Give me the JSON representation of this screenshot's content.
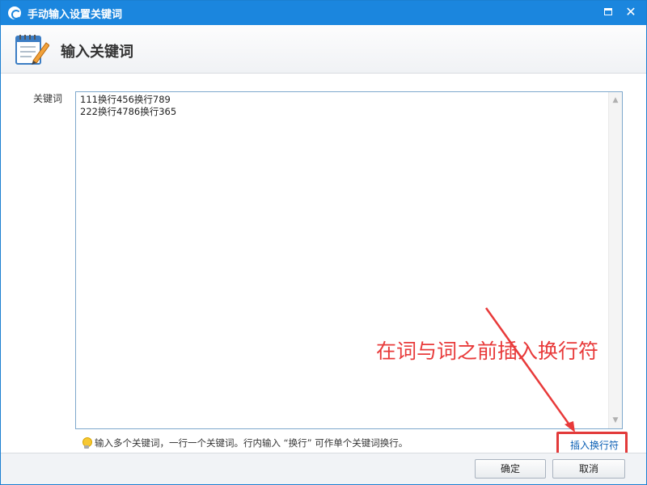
{
  "window": {
    "title": "手动输入设置关键词",
    "maximize_icon": "maximize-icon",
    "close_icon": "close-icon",
    "close_glyph": "✕"
  },
  "header": {
    "title": "输入关键词",
    "icon": "notepad-pen-icon"
  },
  "form": {
    "keyword_label": "关键词",
    "keyword_value": "111换行456换行789\n222换行4786换行365",
    "hint_icon": "lightbulb-icon",
    "hint_text": "输入多个关键词，一行一个关键词。行内输入 “换行” 可作单个关键词换行。",
    "insert_link": "插入换行符"
  },
  "annotation": {
    "text": "在词与词之前插入换行符",
    "color": "#e83a3a"
  },
  "buttons": {
    "ok": "确定",
    "cancel": "取消"
  },
  "colors": {
    "titlebar": "#1b86de",
    "link": "#0b5fb4"
  }
}
